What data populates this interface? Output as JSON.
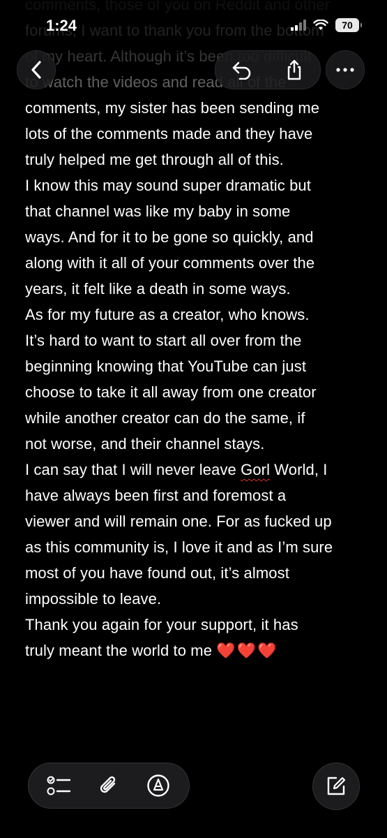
{
  "status_bar": {
    "time": "1:24",
    "battery": "70"
  },
  "note": {
    "lines": [
      "comments, those of you on Reddit and other",
      "forums, I want to thank you from the bottom",
      "of my heart. Although it’s been too difficult",
      "to watch the videos and read all of the",
      "comments, my sister has been sending me",
      "lots of the comments made and they have",
      "truly helped me get through all of this.",
      "I know this may sound super dramatic but",
      "that channel was like my baby in some",
      "ways. And for it to be gone so quickly, and",
      "along with it all of your comments over the",
      "years, it felt like a death in some ways.",
      "As for my future as a creator, who knows.",
      "It’s hard to want to start all over from the",
      "beginning knowing that YouTube can just",
      "choose to take it all away from one creator",
      "while another creator can do the same, if",
      "not worse, and their channel stays.",
      "I can say that I will never leave ",
      "Gorl",
      " World, I",
      "have always been first and foremost a",
      "viewer and will remain one. For as fucked up",
      "as this community is, I love it and as I’m sure",
      "most of you have found out, it’s almost",
      "impossible to leave.",
      "Thank you again for your support, it has",
      "truly meant the world to me ",
      "❤️❤️❤️"
    ]
  },
  "icons": {
    "back": "chevron-left-icon",
    "undo": "undo-icon",
    "share": "share-icon",
    "more": "ellipsis-icon",
    "checklist": "checklist-icon",
    "attach": "paperclip-icon",
    "markup": "pen-circle-icon",
    "compose": "compose-icon"
  },
  "colors": {
    "background": "#000000",
    "text": "#ffffff",
    "accent_hearts": "#e0222a",
    "spellcheck": "#dd3333"
  }
}
